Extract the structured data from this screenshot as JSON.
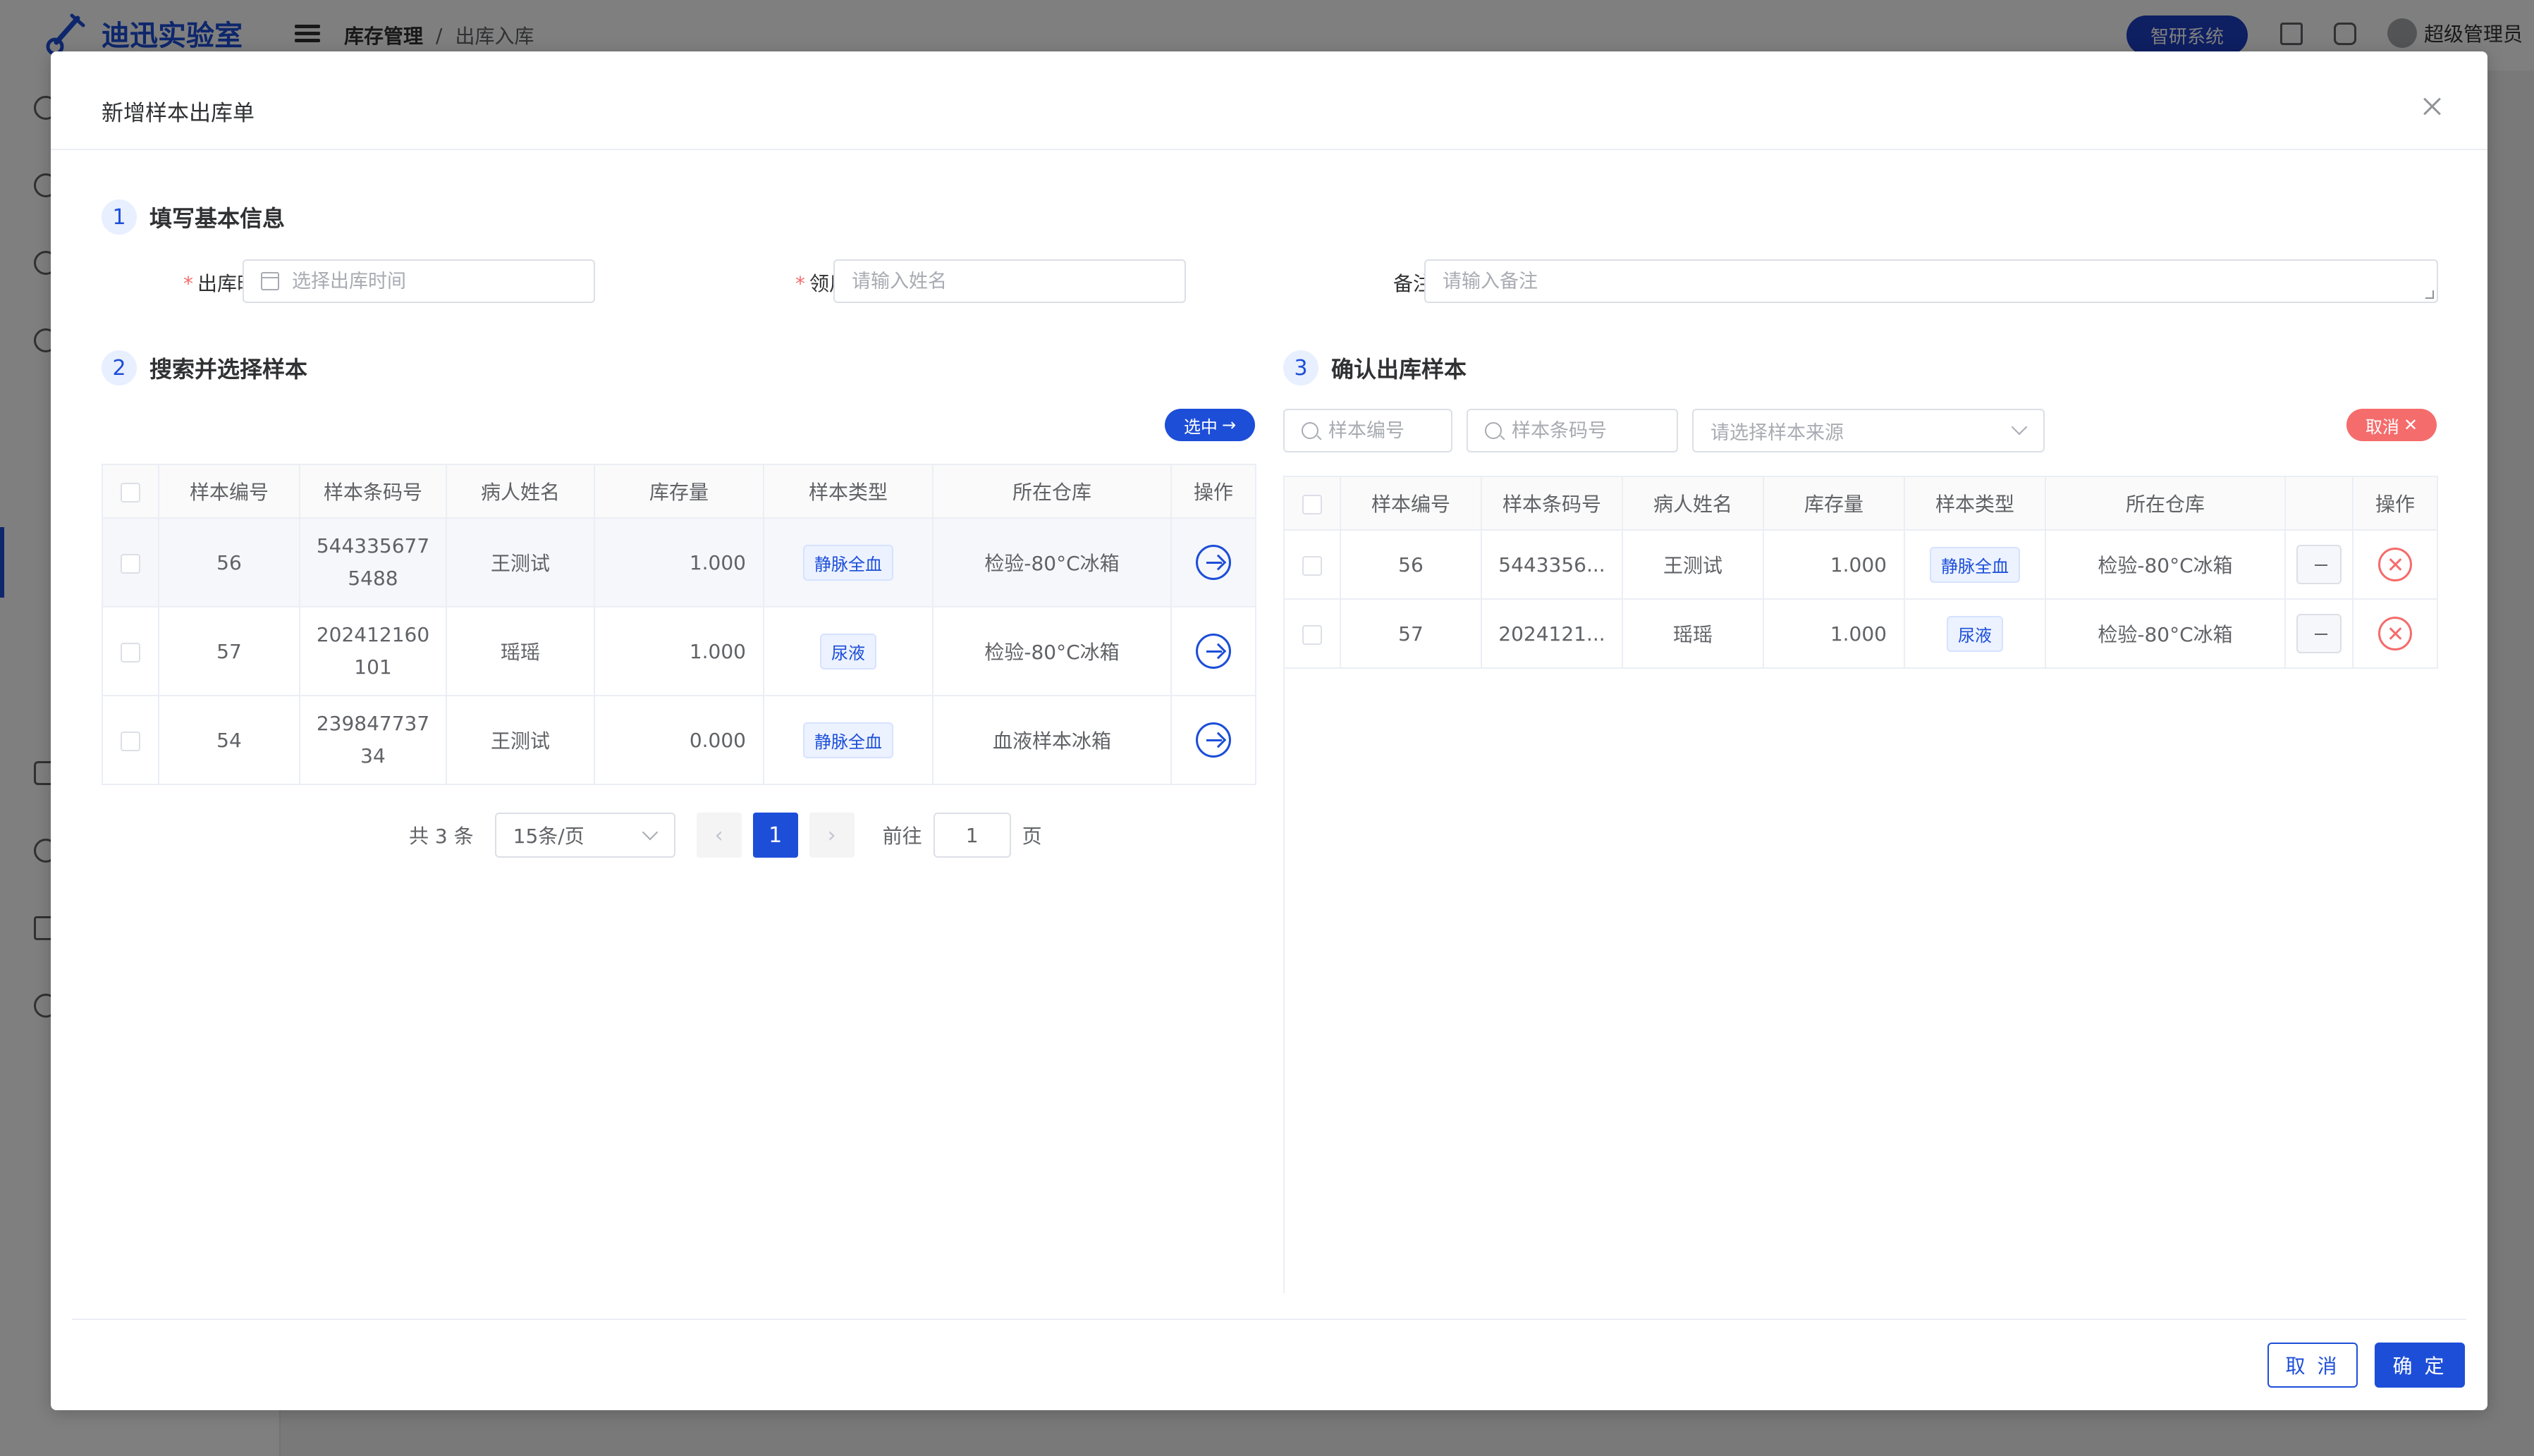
{
  "background": {
    "logo_text": "迪迅实验室",
    "breadcrumb": [
      "库存管理",
      "/",
      "出库入库"
    ],
    "system_button": "智研系统",
    "user_name": "超级管理员"
  },
  "dialog": {
    "title": "新增样本出库单",
    "step1": {
      "num": "1",
      "title": "填写基本信息",
      "time_label": "出库时间",
      "time_placeholder": "选择出库时间",
      "person_label": "领用人",
      "person_placeholder": "请输入姓名",
      "remark_label": "备注",
      "remark_placeholder": "请输入备注"
    },
    "step2": {
      "num": "2",
      "title": "搜索并选择样本",
      "select_button": "选中",
      "columns": [
        "样本编号",
        "样本条码号",
        "病人姓名",
        "库存量",
        "样本类型",
        "所在仓库",
        "操作"
      ],
      "rows": [
        {
          "id": "56",
          "barcode": "5443356775488",
          "patient": "王测试",
          "stock": "1.000",
          "type": "静脉全血",
          "warehouse": "检验-80°C冰箱"
        },
        {
          "id": "57",
          "barcode": "202412160101",
          "patient": "瑶瑶",
          "stock": "1.000",
          "type": "尿液",
          "warehouse": "检验-80°C冰箱"
        },
        {
          "id": "54",
          "barcode": "23984773734",
          "patient": "王测试",
          "stock": "0.000",
          "type": "静脉全血",
          "warehouse": "血液样本冰箱"
        }
      ],
      "pager": {
        "total_text": "共 3 条",
        "page_size": "15条/页",
        "prev": "‹",
        "current": "1",
        "next": "›",
        "goto_label": "前往",
        "goto_value": "1",
        "page_unit": "页"
      }
    },
    "step3": {
      "num": "3",
      "title": "确认出库样本",
      "search_id_placeholder": "样本编号",
      "search_barcode_placeholder": "样本条码号",
      "source_placeholder": "请选择样本来源",
      "cancel_button": "取消",
      "columns": [
        "样本编号",
        "样本条码号",
        "病人姓名",
        "库存量",
        "样本类型",
        "所在仓库",
        "",
        "操作"
      ],
      "rows": [
        {
          "id": "56",
          "barcode": "5443356...",
          "patient": "王测试",
          "stock": "1.000",
          "type": "静脉全血",
          "warehouse": "检验-80°C冰箱"
        },
        {
          "id": "57",
          "barcode": "2024121...",
          "patient": "瑶瑶",
          "stock": "1.000",
          "type": "尿液",
          "warehouse": "检验-80°C冰箱"
        }
      ]
    },
    "footer": {
      "cancel": "取 消",
      "confirm": "确 定"
    }
  }
}
